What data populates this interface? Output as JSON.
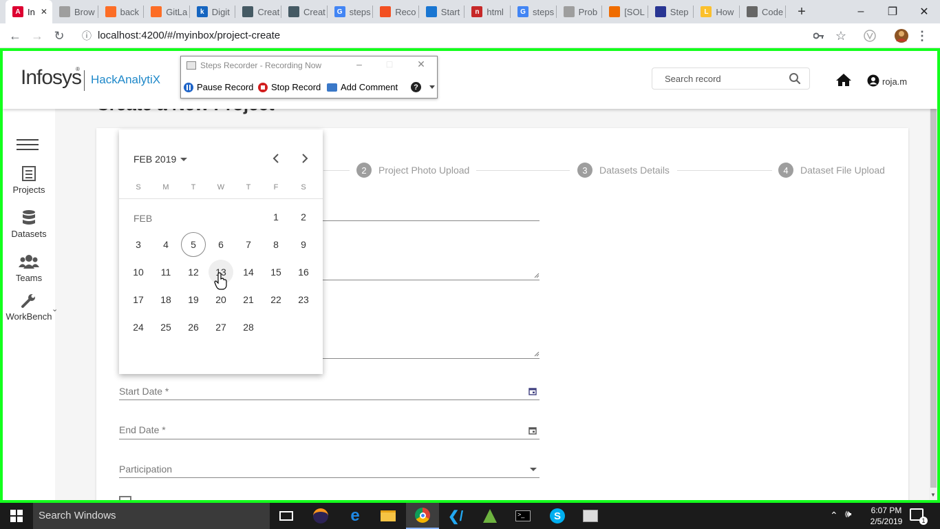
{
  "browser": {
    "tabs": [
      {
        "label": "In",
        "favicon_color": "#dd0031",
        "favicon_glyph": "A",
        "active": true
      },
      {
        "label": "Brow",
        "favicon_color": "#9e9e9e",
        "favicon_glyph": ""
      },
      {
        "label": "back",
        "favicon_color": "#fc6d26",
        "favicon_glyph": ""
      },
      {
        "label": "GitLa",
        "favicon_color": "#fc6d26",
        "favicon_glyph": ""
      },
      {
        "label": "Digit",
        "favicon_color": "#1565c0",
        "favicon_glyph": "k"
      },
      {
        "label": "Creat",
        "favicon_color": "#455a64",
        "favicon_glyph": ""
      },
      {
        "label": "Creat",
        "favicon_color": "#455a64",
        "favicon_glyph": ""
      },
      {
        "label": "steps",
        "favicon_color": "#4285f4",
        "favicon_glyph": "G"
      },
      {
        "label": "Reco",
        "favicon_color": "#f25022",
        "favicon_glyph": ""
      },
      {
        "label": "Start",
        "favicon_color": "#1976d2",
        "favicon_glyph": ""
      },
      {
        "label": "html",
        "favicon_color": "#c62828",
        "favicon_glyph": "n"
      },
      {
        "label": "steps",
        "favicon_color": "#4285f4",
        "favicon_glyph": "G"
      },
      {
        "label": "Prob",
        "favicon_color": "#9e9e9e",
        "favicon_glyph": ""
      },
      {
        "label": "[SOL",
        "favicon_color": "#ef6c00",
        "favicon_glyph": ""
      },
      {
        "label": "Step",
        "favicon_color": "#283593",
        "favicon_glyph": ""
      },
      {
        "label": "How",
        "favicon_color": "#fbc02d",
        "favicon_glyph": "L"
      },
      {
        "label": "Code",
        "favicon_color": "#666666",
        "favicon_glyph": ""
      }
    ],
    "url": "localhost:4200/#/myinbox/project-create"
  },
  "header": {
    "logo_text": "Infosys",
    "brand_text": "HackAnalytiX",
    "search_placeholder": "Search record",
    "user_name": "roja.m"
  },
  "steps_recorder": {
    "title": "Steps Recorder - Recording Now",
    "pause_label": "Pause Record",
    "stop_label": "Stop Record",
    "comment_label": "Add Comment"
  },
  "sidebar": {
    "items": [
      {
        "label": "Projects"
      },
      {
        "label": "Datasets"
      },
      {
        "label": "Teams"
      },
      {
        "label": "WorkBench"
      }
    ]
  },
  "page": {
    "title": "Create a New Project",
    "steps": [
      {
        "num": "2",
        "label": "Project Photo Upload"
      },
      {
        "num": "3",
        "label": "Datasets Details"
      },
      {
        "num": "4",
        "label": "Dataset File Upload"
      }
    ],
    "fields": {
      "start_date": "Start Date *",
      "end_date": "End Date *",
      "participation": "Participation"
    }
  },
  "datepicker": {
    "period_label": "FEB 2019",
    "weekdays": [
      "S",
      "M",
      "T",
      "W",
      "T",
      "F",
      "S"
    ],
    "month_label": "FEB",
    "weeks": [
      [
        "",
        "",
        "",
        "",
        "",
        "1",
        "2"
      ],
      [
        "3",
        "4",
        "5",
        "6",
        "7",
        "8",
        "9"
      ],
      [
        "10",
        "11",
        "12",
        "13",
        "14",
        "15",
        "16"
      ],
      [
        "17",
        "18",
        "19",
        "20",
        "21",
        "22",
        "23"
      ],
      [
        "24",
        "25",
        "26",
        "27",
        "28",
        "",
        ""
      ]
    ],
    "today": "5",
    "hovered": "13"
  },
  "taskbar": {
    "search_placeholder": "Search Windows",
    "time": "6:07 PM",
    "date": "2/5/2019"
  },
  "colors": {
    "recording_frame": "#14ff1d",
    "brand_blue": "#1e88c9",
    "step_grey": "#9e9e9e"
  }
}
